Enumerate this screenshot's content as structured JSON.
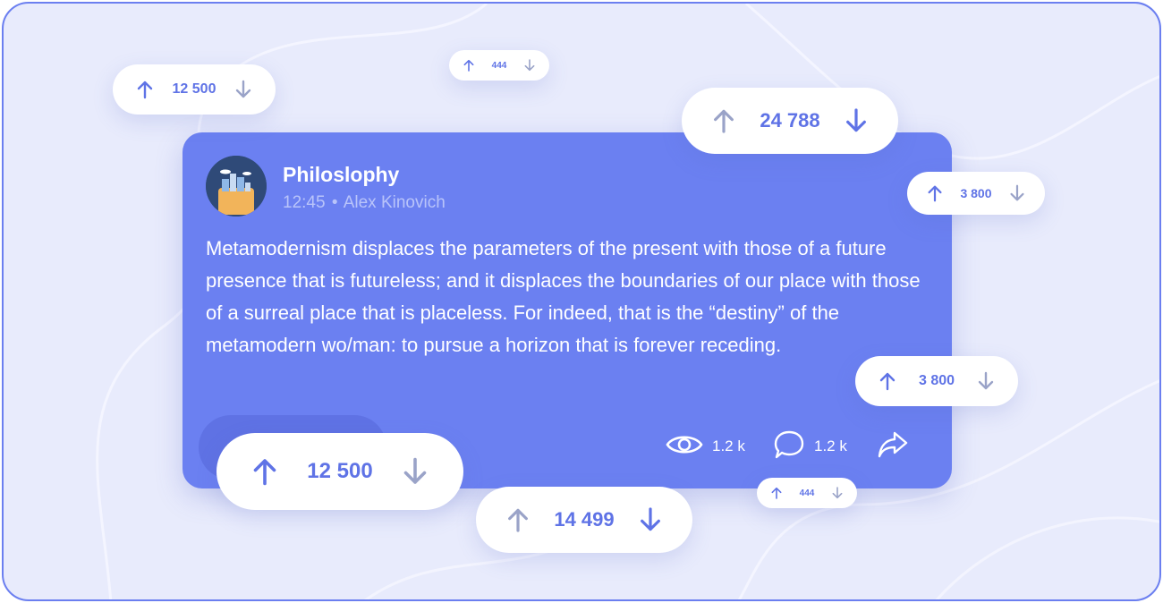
{
  "post": {
    "community": "Philoslophy",
    "time": "12:45",
    "separator": "•",
    "author": "Alex Kinovich",
    "text": "Metamodernism displaces the parameters of the present with those of a future presence that is futureless; and it displaces the boundaries of our place with those of a surreal place that is placeless. For indeed, that is the “destiny” of the metamodern wo/man: to pursue a horizon that is forever receding.",
    "views": "1.2 k",
    "comments": "1.2 k"
  },
  "vote_pills": [
    {
      "count": "12 500"
    },
    {
      "count": "444"
    },
    {
      "count": "24 788"
    },
    {
      "count": "3 800"
    },
    {
      "count": "3 800"
    },
    {
      "count": "12 500"
    },
    {
      "count": "14 499"
    },
    {
      "count": "444"
    }
  ],
  "icons": {
    "upvote": "arrow-up-icon",
    "downvote": "arrow-down-icon",
    "views": "eye-icon",
    "comments": "comment-icon",
    "share": "share-icon"
  },
  "colors": {
    "frame_border": "#6b7ff0",
    "background": "#e8ebfc",
    "card": "#6b80f1",
    "accent": "#5f73e6",
    "muted_arrow": "#9aa3c8"
  }
}
